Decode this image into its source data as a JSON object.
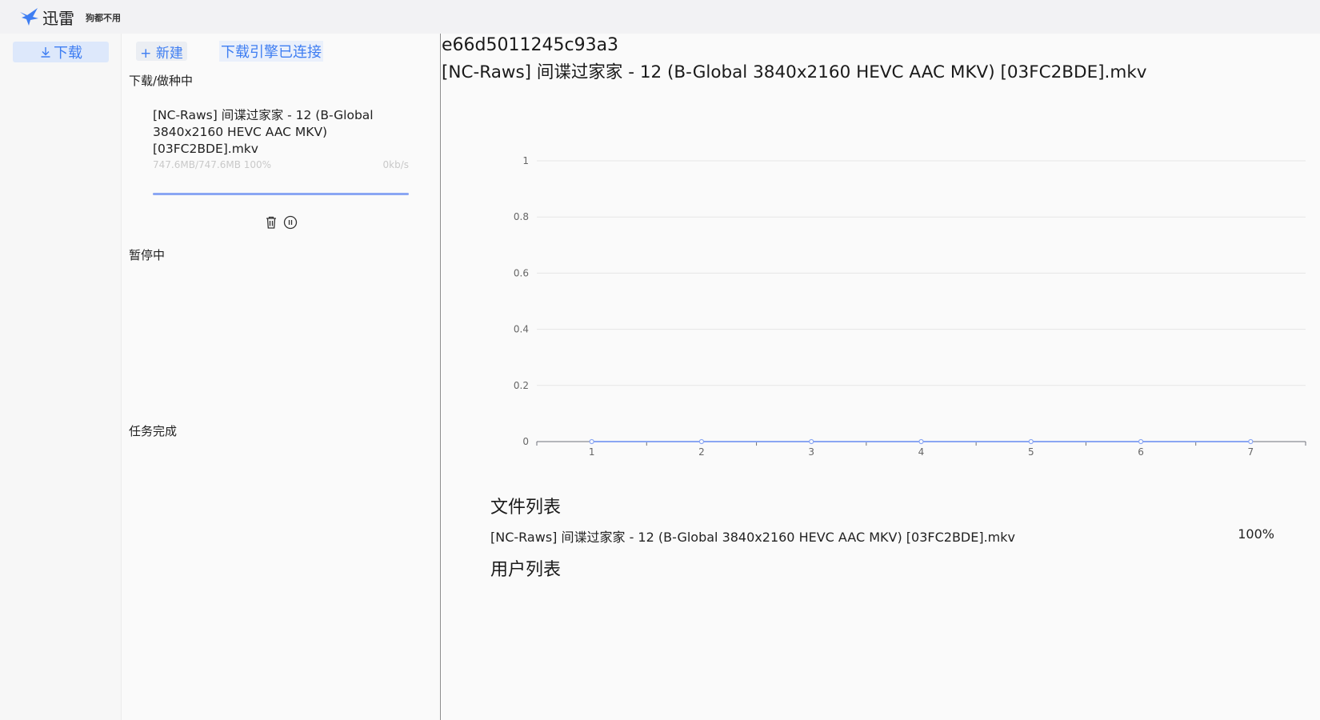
{
  "app": {
    "name": "迅雷",
    "slogan": "狗都不用",
    "accent_color": "#3f7ef2"
  },
  "nav": {
    "items": [
      {
        "label": "下载",
        "icon": "download-icon",
        "active": true
      }
    ]
  },
  "toolbar": {
    "new_label": "+ 新建",
    "engine_status": "下载引擎已连接"
  },
  "sections": {
    "downloading": "下载/做种中",
    "paused": "暂停中",
    "completed": "任务完成"
  },
  "downloading_tasks": [
    {
      "name": "[NC-Raws] 间谍过家家 - 12 (B-Global 3840x2160 HEVC AAC MKV) [03FC2BDE].mkv",
      "size_text": "747.6MB/747.6MB 100%",
      "speed": "0kb/s",
      "progress": 1.0,
      "actions": [
        "trash-icon",
        "pause-circle-icon"
      ]
    }
  ],
  "detail": {
    "hash": "e66d5011245c93a3",
    "name": "[NC-Raws] 间谍过家家 - 12 (B-Global 3840x2160 HEVC AAC MKV) [03FC2BDE].mkv",
    "file_list_title": "文件列表",
    "files": [
      {
        "name": "[NC-Raws] 间谍过家家 - 12 (B-Global 3840x2160 HEVC AAC MKV) [03FC2BDE].mkv",
        "progress": "100%"
      }
    ],
    "user_list_title": "用户列表"
  },
  "chart_data": {
    "type": "line",
    "x": [
      1,
      2,
      3,
      4,
      5,
      6,
      7
    ],
    "series": [
      {
        "values": [
          0,
          0,
          0,
          0,
          0,
          0,
          0
        ]
      }
    ],
    "ylim": [
      0,
      1
    ],
    "yticks": [
      0,
      0.2,
      0.4,
      0.6,
      0.8,
      1
    ],
    "xticks": [
      1,
      2,
      3,
      4,
      5,
      6,
      7
    ],
    "grid": true,
    "line_color": "#8aa6f3",
    "title": "",
    "xlabel": "",
    "ylabel": ""
  }
}
